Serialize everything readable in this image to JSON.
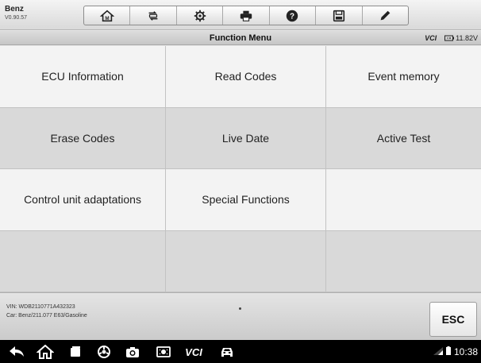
{
  "app": {
    "name": "Benz",
    "version": "V0.90.57"
  },
  "toolbar": {
    "buttons": [
      {
        "icon": "home-icon"
      },
      {
        "icon": "vehicle-swap-icon"
      },
      {
        "icon": "settings-gear-icon"
      },
      {
        "icon": "print-icon"
      },
      {
        "icon": "help-icon"
      },
      {
        "icon": "save-icon"
      },
      {
        "icon": "edit-pen-icon"
      }
    ]
  },
  "header": {
    "title": "Function Menu",
    "vci_label": "VCI",
    "battery_voltage": "11.82V"
  },
  "functions": [
    [
      "ECU Information",
      "Read Codes",
      "Event memory"
    ],
    [
      "Erase Codes",
      "Live Date",
      "Active Test"
    ],
    [
      "Control unit adaptations",
      "Special Functions",
      ""
    ],
    [
      "",
      "",
      ""
    ]
  ],
  "footer": {
    "vin": "VIN: WDB2110771A432323",
    "car": "Car: Benz/211.077 E63/Gasoline",
    "esc_label": "ESC"
  },
  "navbar": {
    "vci_label": "VCI",
    "time": "10:38"
  },
  "colors": {
    "toolbar": "#dcdcdc",
    "row_light": "#f3f3f3",
    "row_dark": "#d9d9d9",
    "navbar": "#000000"
  }
}
